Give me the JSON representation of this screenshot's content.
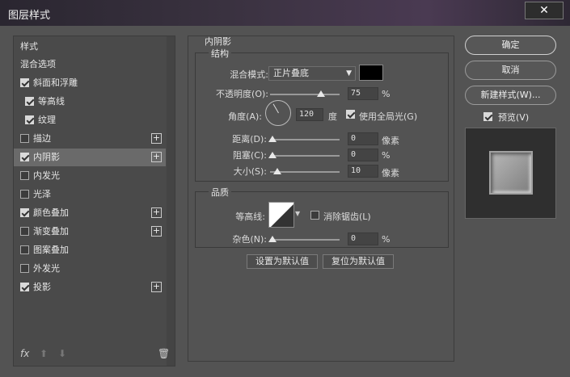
{
  "window": {
    "title": "图层样式",
    "close": "✕"
  },
  "left_panel": {
    "items": [
      {
        "label": "样式",
        "checkbox": false,
        "checked": false,
        "plus": false,
        "selected": false
      },
      {
        "label": "混合选项",
        "checkbox": false,
        "checked": false,
        "plus": false,
        "selected": false
      },
      {
        "label": "斜面和浮雕",
        "checkbox": true,
        "checked": true,
        "plus": false,
        "selected": false
      },
      {
        "label": "等高线",
        "checkbox": true,
        "checked": true,
        "plus": false,
        "selected": false,
        "indent": true
      },
      {
        "label": "纹理",
        "checkbox": true,
        "checked": true,
        "plus": false,
        "selected": false,
        "indent": true
      },
      {
        "label": "描边",
        "checkbox": true,
        "checked": false,
        "plus": true,
        "selected": false
      },
      {
        "label": "内阴影",
        "checkbox": true,
        "checked": true,
        "plus": true,
        "selected": true
      },
      {
        "label": "内发光",
        "checkbox": true,
        "checked": false,
        "plus": false,
        "selected": false
      },
      {
        "label": "光泽",
        "checkbox": true,
        "checked": false,
        "plus": false,
        "selected": false
      },
      {
        "label": "颜色叠加",
        "checkbox": true,
        "checked": true,
        "plus": true,
        "selected": false
      },
      {
        "label": "渐变叠加",
        "checkbox": true,
        "checked": false,
        "plus": true,
        "selected": false
      },
      {
        "label": "图案叠加",
        "checkbox": true,
        "checked": false,
        "plus": false,
        "selected": false
      },
      {
        "label": "外发光",
        "checkbox": true,
        "checked": false,
        "plus": false,
        "selected": false
      },
      {
        "label": "投影",
        "checkbox": true,
        "checked": true,
        "plus": true,
        "selected": false
      }
    ],
    "footer": {
      "fx": "fx",
      "up": "⬆",
      "down": "⬇",
      "trash": "🗑"
    }
  },
  "inner_shadow": {
    "section_title": "内阴影",
    "structure": {
      "title": "结构",
      "blend_mode_label": "混合模式:",
      "blend_mode_value": "正片叠底",
      "swatch_color": "#000000",
      "opacity_label": "不透明度(O):",
      "opacity_value": "75",
      "opacity_unit": "%",
      "opacity_fraction": 0.75,
      "angle_label": "角度(A):",
      "angle_value": "120",
      "angle_unit": "度",
      "global_light_label": "使用全局光(G)",
      "global_light_checked": true,
      "distance_label": "距离(D):",
      "distance_value": "0",
      "distance_unit": "像素",
      "choke_label": "阻塞(C):",
      "choke_value": "0",
      "choke_unit": "%",
      "size_label": "大小(S):",
      "size_value": "10",
      "size_unit": "像素"
    },
    "quality": {
      "title": "品质",
      "contour_label": "等高线:",
      "antialias_label": "消除锯齿(L)",
      "antialias_checked": false,
      "noise_label": "杂色(N):",
      "noise_value": "0",
      "noise_unit": "%"
    },
    "buttons": {
      "set_default": "设置为默认值",
      "reset_default": "复位为默认值"
    }
  },
  "right_panel": {
    "ok": "确定",
    "cancel": "取消",
    "new_style": "新建样式(W)...",
    "preview_label": "预览(V)",
    "preview_checked": true
  }
}
